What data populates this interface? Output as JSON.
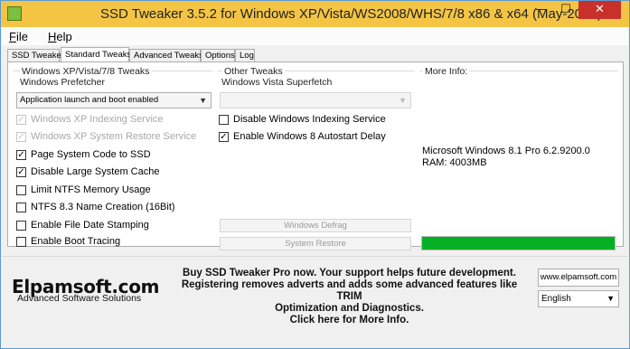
{
  "window": {
    "title": "SSD Tweaker 3.5.2 for Windows XP/Vista/WS2008/WHS/7/8 x86 & x64 (May-2015)",
    "minimize_glyph": "—",
    "maximize_glyph": "☐",
    "close_glyph": "✕"
  },
  "menu": [
    {
      "underline": "F",
      "rest": "ile"
    },
    {
      "underline": "H",
      "rest": "elp"
    }
  ],
  "tabs": [
    "SSD Tweaker",
    "Standard Tweaks",
    "Advanced Tweaks",
    "Options",
    "Log"
  ],
  "active_tab": "Standard Tweaks",
  "left_group": {
    "title": "Windows XP/Vista/7/8 Tweaks",
    "prefetcher_label": "Windows Prefetcher",
    "prefetcher_value": "Application launch and boot enabled",
    "checkboxes": [
      {
        "label": "Windows XP Indexing Service",
        "checked": true,
        "disabled": true
      },
      {
        "label": "Windows XP System Restore Service",
        "checked": true,
        "disabled": true
      },
      {
        "label": "Page System Code to SSD",
        "checked": true,
        "disabled": false
      },
      {
        "label": "Disable Large System Cache",
        "checked": true,
        "disabled": false
      },
      {
        "label": "Limit NTFS Memory Usage",
        "checked": false,
        "disabled": false
      },
      {
        "label": "NTFS 8.3 Name Creation (16Bit)",
        "checked": false,
        "disabled": false
      },
      {
        "label": "Enable File Date Stamping",
        "checked": false,
        "disabled": false
      },
      {
        "label": "Enable Boot Tracing",
        "checked": false,
        "disabled": false
      }
    ]
  },
  "mid_group": {
    "title": "Other Tweaks",
    "superfetch_label": "Windows Vista Superfetch",
    "superfetch_value": "",
    "checkboxes": [
      {
        "label": "Disable Windows Indexing Service",
        "checked": false,
        "disabled": false
      },
      {
        "label": "Enable Windows 8 Autostart Delay",
        "checked": true,
        "disabled": false
      }
    ],
    "buttons": [
      "Windows Defrag",
      "System Restore"
    ]
  },
  "info_group": {
    "title": "More Info:",
    "lines": [
      "Microsoft Windows 8.1 Pro 6.2.9200.0",
      "RAM: 4003MB"
    ],
    "progress_fraction": 1.0,
    "progress_color": "#06b025"
  },
  "footer": {
    "logo": "Elpamsoft.com",
    "logo_sub": "Advanced Software Solutions",
    "promo_lines": [
      "Buy SSD Tweaker Pro now. Your support helps future development.",
      "Registering removes adverts and adds some advanced features like TRIM",
      "Optimization and Diagnostics.",
      "Click here for More Info."
    ],
    "website_button": "www.elpamsoft.com",
    "language": "English"
  },
  "colors": {
    "titlebar": "#f4c544",
    "close_button": "#c7302b"
  }
}
